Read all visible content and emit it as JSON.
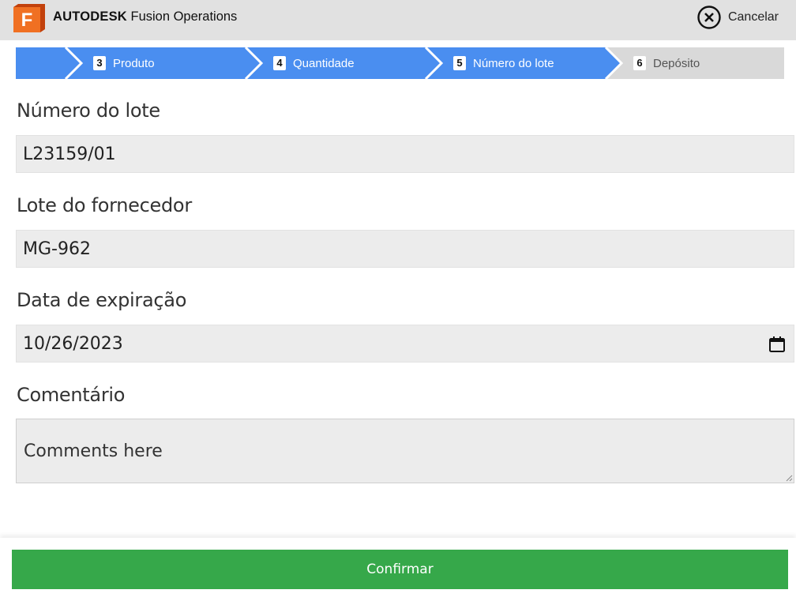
{
  "app": {
    "logo_letter": "F",
    "brand_strong": "AUTODESK",
    "brand_product": "Fusion Operations"
  },
  "header": {
    "cancel_label": "Cancelar",
    "cancel_icon": "close-circle-icon"
  },
  "stepper": {
    "steps": [
      {
        "number": "3",
        "label": "Produto",
        "state": "done"
      },
      {
        "number": "4",
        "label": "Quantidade",
        "state": "done"
      },
      {
        "number": "5",
        "label": "Número do lote",
        "state": "current"
      },
      {
        "number": "6",
        "label": "Depósito",
        "state": "pending"
      }
    ],
    "done_color": "#4a8ef0",
    "pending_color": "#d9d9d9"
  },
  "form": {
    "lot_number": {
      "label": "Número do lote",
      "value": "L23159/01"
    },
    "supplier_lot": {
      "label": "Lote do fornecedor",
      "value": "MG-962"
    },
    "expiration_date": {
      "label": "Data de expiração",
      "value": "10/26/2023",
      "icon": "calendar-icon"
    },
    "comment": {
      "label": "Comentário",
      "placeholder": "Comments here"
    }
  },
  "footer": {
    "confirm_label": "Confirmar",
    "confirm_color": "#36a84a"
  }
}
